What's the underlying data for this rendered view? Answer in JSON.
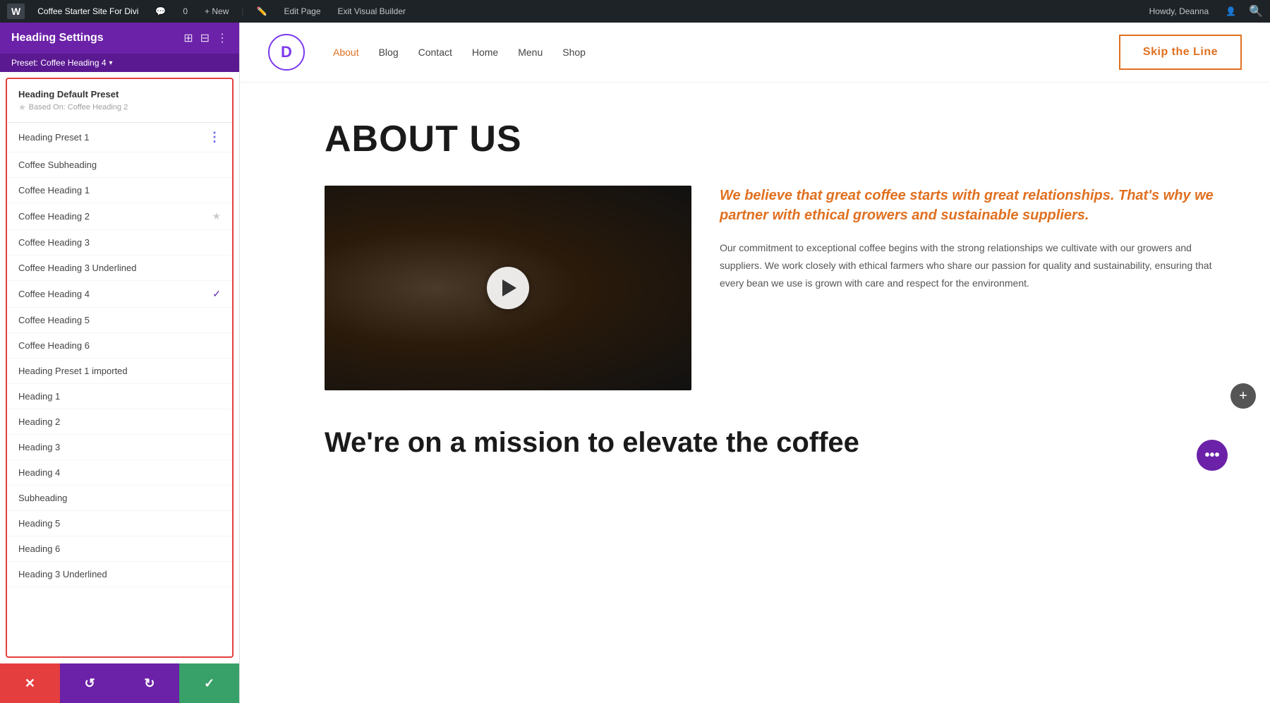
{
  "adminBar": {
    "logo": "W",
    "site_name": "Coffee Starter Site For Divi",
    "comment_count": "0",
    "new_label": "+ New",
    "edit_page": "Edit Page",
    "exit_builder": "Exit Visual Builder",
    "howdy": "Howdy, Deanna"
  },
  "panel": {
    "title": "Heading Settings",
    "preset_label": "Preset: Coffee Heading 4",
    "default_preset": {
      "title": "Heading Default Preset",
      "based_on": "Based On: Coffee Heading 2"
    },
    "presets": [
      {
        "id": 1,
        "label": "Heading Preset 1",
        "icon": "dots",
        "active": false
      },
      {
        "id": 2,
        "label": "Coffee Subheading",
        "icon": null,
        "active": false
      },
      {
        "id": 3,
        "label": "Coffee Heading 1",
        "icon": null,
        "active": false
      },
      {
        "id": 4,
        "label": "Coffee Heading 2",
        "icon": "star",
        "active": false
      },
      {
        "id": 5,
        "label": "Coffee Heading 3",
        "icon": null,
        "active": false
      },
      {
        "id": 6,
        "label": "Coffee Heading 3 Underlined",
        "icon": null,
        "active": false
      },
      {
        "id": 7,
        "label": "Coffee Heading 4",
        "icon": "check",
        "active": true
      },
      {
        "id": 8,
        "label": "Coffee Heading 5",
        "icon": null,
        "active": false
      },
      {
        "id": 9,
        "label": "Coffee Heading 6",
        "icon": null,
        "active": false
      },
      {
        "id": 10,
        "label": "Heading Preset 1 imported",
        "icon": null,
        "active": false
      },
      {
        "id": 11,
        "label": "Heading 1",
        "icon": null,
        "active": false
      },
      {
        "id": 12,
        "label": "Heading 2",
        "icon": null,
        "active": false
      },
      {
        "id": 13,
        "label": "Heading 3",
        "icon": null,
        "active": false
      },
      {
        "id": 14,
        "label": "Heading 4",
        "icon": null,
        "active": false
      },
      {
        "id": 15,
        "label": "Subheading",
        "icon": null,
        "active": false
      },
      {
        "id": 16,
        "label": "Heading 5",
        "icon": null,
        "active": false
      },
      {
        "id": 17,
        "label": "Heading 6",
        "icon": null,
        "active": false
      },
      {
        "id": 18,
        "label": "Heading 3 Underlined",
        "icon": null,
        "active": false
      }
    ],
    "actions": {
      "cancel": "✕",
      "undo": "↺",
      "redo": "↻",
      "save": "✓"
    }
  },
  "site": {
    "logo": "D",
    "nav": {
      "links": [
        "About",
        "Blog",
        "Contact",
        "Home",
        "Menu",
        "Shop"
      ],
      "active": "About"
    },
    "cta_button": "Skip the Line"
  },
  "page": {
    "title": "ABOUT US",
    "highlight_text": "We believe that great coffee starts with great relationships. That's why we partner with ethical growers and sustainable suppliers.",
    "body_text": "Our commitment to exceptional coffee begins with the strong relationships we cultivate with our growers and suppliers. We work closely with ethical farmers who share our passion for quality and sustainability, ensuring that every bean we use is grown with care and respect for the environment.",
    "mission_heading": "We're on a mission to elevate the coffee"
  }
}
